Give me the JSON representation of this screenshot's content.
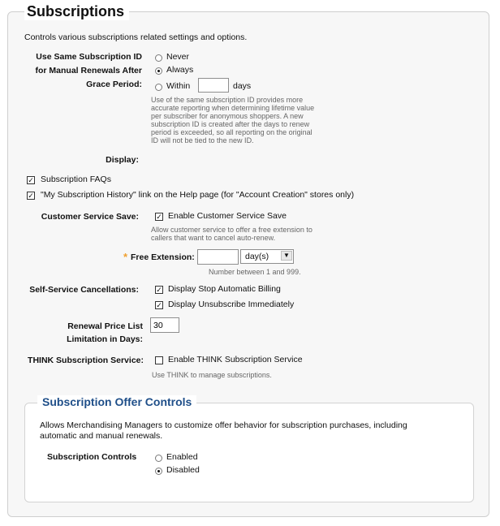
{
  "page_title": "Subscriptions",
  "description": "Controls various subscriptions related settings and options.",
  "same_sub_id": {
    "label_lines": [
      "Use Same Subscription ID",
      "for Manual Renewals After",
      "Grace Period:"
    ],
    "options": [
      "Never",
      "Always",
      "Within"
    ],
    "selected": "Always",
    "within_value": "",
    "days_label": "days",
    "help_lines": [
      "Use of the same subscription ID provides more",
      "accurate reporting when determining lifetime value",
      "per subscriber for anonymous shoppers. A new",
      "subscription ID is created after the days to renew",
      "period is exceeded, so all reporting on the original",
      "ID will not be tied to the new ID."
    ]
  },
  "display": {
    "label": "Display:",
    "faqs_label": "Subscription FAQs",
    "faqs_checked": true,
    "history_label": "\"My Subscription History\" link on the Help page (for \"Account Creation\" stores only)",
    "history_checked": true
  },
  "customer_service": {
    "label": "Customer Service Save:",
    "checkbox_label": "Enable Customer Service Save",
    "checked": true,
    "help_lines": [
      "Allow customer service to offer a free extension to",
      "callers that want to cancel auto-renew."
    ]
  },
  "free_extension": {
    "required_mark": "*",
    "label": "Free Extension:",
    "value": "",
    "unit_selected": "day(s)",
    "help": "Number between 1 and 999."
  },
  "self_service": {
    "label": "Self-Service Cancellations:",
    "stop_billing_label": "Display Stop Automatic Billing",
    "stop_billing_checked": true,
    "unsubscribe_label": "Display Unsubscribe Immediately",
    "unsubscribe_checked": true
  },
  "renewal_price": {
    "label_lines": [
      "Renewal Price List",
      "Limitation in Days:"
    ],
    "value": "30"
  },
  "think": {
    "label": "THINK Subscription Service:",
    "checkbox_label": "Enable THINK Subscription Service",
    "checked": false,
    "help": "Use THINK to manage subscriptions."
  },
  "offer_controls": {
    "title": "Subscription Offer Controls",
    "description_lines": [
      "Allows Merchandising Managers to customize offer behavior for subscription purchases, including",
      "automatic and manual renewals."
    ],
    "label": "Subscription Controls",
    "options": [
      "Enabled",
      "Disabled"
    ],
    "selected": "Disabled"
  }
}
